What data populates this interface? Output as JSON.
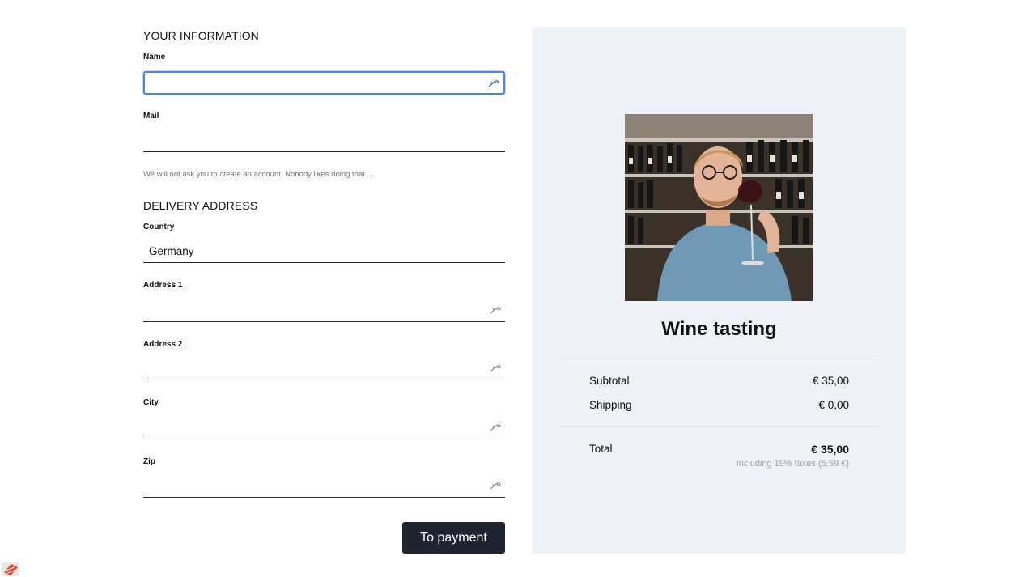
{
  "your_information": {
    "title": "YOUR INFORMATION",
    "name_label": "Name",
    "name_value": "",
    "mail_label": "Mail",
    "mail_value": "",
    "helper_text": "We will not ask you to create an account. Nobody likes doing that ..."
  },
  "delivery_address": {
    "title": "DELIVERY ADDRESS",
    "country_label": "Country",
    "country_value": "Germany",
    "address1_label": "Address 1",
    "address2_label": "Address 2",
    "city_label": "City",
    "zip_label": "Zip"
  },
  "actions": {
    "payment_button": "To payment"
  },
  "summary": {
    "product_title": "Wine tasting",
    "subtotal_label": "Subtotal",
    "subtotal_value": "€ 35,00",
    "shipping_label": "Shipping",
    "shipping_value": "€ 0,00",
    "total_label": "Total",
    "total_value": "€ 35,00",
    "tax_note": "Including 19% taxes (5,59 €)"
  },
  "icons": {
    "autofill": "key-icon",
    "corner": "app-icon"
  },
  "colors": {
    "button_bg": "#1f2430",
    "summary_bg": "#eef1f5",
    "focus_ring": "#4a86e8"
  }
}
